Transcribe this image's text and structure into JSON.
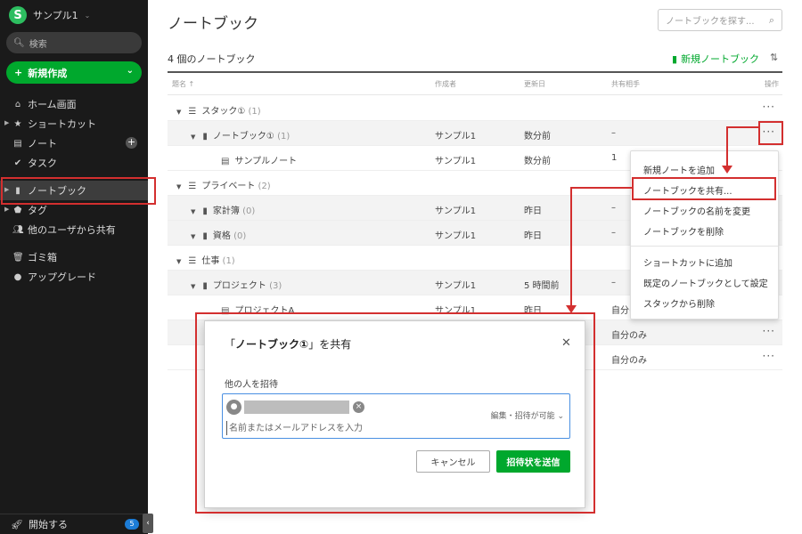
{
  "sidebar": {
    "account": "サンプル1",
    "search": "検索",
    "new_button": "新規作成",
    "items": [
      {
        "label": "ホーム画面"
      },
      {
        "label": "ショートカット"
      },
      {
        "label": "ノート"
      },
      {
        "label": "タスク"
      },
      {
        "label": "ノートブック"
      },
      {
        "label": "タグ"
      },
      {
        "label": "他のユーザから共有"
      },
      {
        "label": "ゴミ箱"
      },
      {
        "label": "アップグレード"
      }
    ],
    "footer": "開始する",
    "footer_badge": "5"
  },
  "main": {
    "title": "ノートブック",
    "search_placeholder": "ノートブックを探す...",
    "count_label": "4 個のノートブック",
    "new_notebook": "新規ノートブック",
    "headers": {
      "name": "題名 ↑",
      "creator": "作成者",
      "updated": "更新日",
      "shared": "共有相手",
      "actions": "操作"
    },
    "rows": [
      {
        "name": "スタック①",
        "count": "(1)"
      },
      {
        "name": "ノートブック①",
        "count": "(1)",
        "creator": "サンプル1",
        "updated": "数分前",
        "shared": "–"
      },
      {
        "name": "サンプルノート",
        "creator": "サンプル1",
        "updated": "数分前",
        "shared": "1"
      },
      {
        "name": "プライベート",
        "count": "(2)"
      },
      {
        "name": "家計簿",
        "count": "(0)",
        "creator": "サンプル1",
        "updated": "昨日",
        "shared": "–"
      },
      {
        "name": "資格",
        "count": "(0)",
        "creator": "サンプル1",
        "updated": "昨日",
        "shared": "–"
      },
      {
        "name": "仕事",
        "count": "(1)"
      },
      {
        "name": "プロジェクト",
        "count": "(3)",
        "creator": "サンプル1",
        "updated": "5 時間前",
        "shared": "–"
      },
      {
        "name": "プロジェクトA",
        "creator": "サンプル1",
        "updated": "昨日",
        "shared": "自分のみ"
      },
      {
        "shared": "自分のみ"
      },
      {
        "shared": "自分のみ"
      }
    ]
  },
  "context_menu": [
    "新規ノートを追加",
    "ノートブックを共有...",
    "ノートブックの名前を変更",
    "ノートブックを削除",
    "ショートカットに追加",
    "既定のノートブックとして設定",
    "スタックから削除"
  ],
  "dialog": {
    "title_prefix": "「",
    "title_name": "ノートブック①",
    "title_suffix": "」を共有",
    "invite_label": "他の人を招待",
    "permission": "編集・招待が可能",
    "input_placeholder": "名前またはメールアドレスを入力",
    "cancel": "キャンセル",
    "send": "招待状を送信"
  },
  "colors": {
    "accent": "#00a82d",
    "annotation": "#d32f2f",
    "sidebar_bg": "#1a1a1a"
  }
}
